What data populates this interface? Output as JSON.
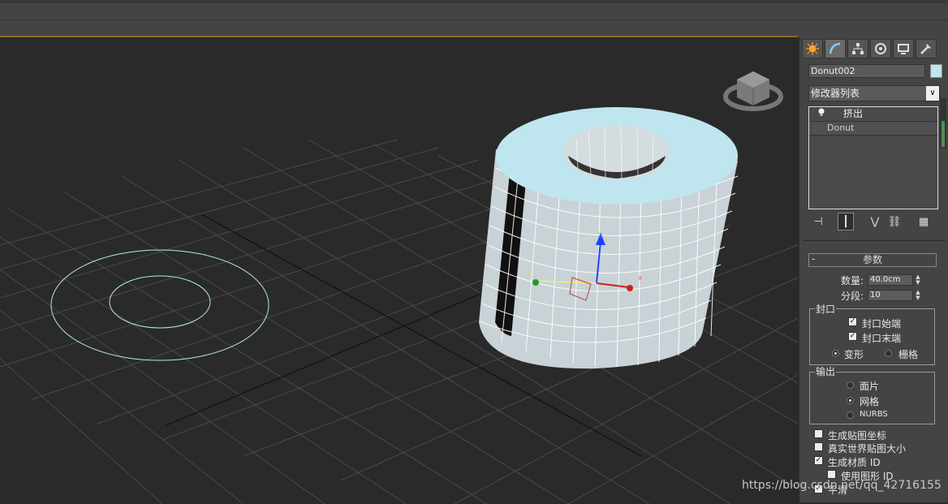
{
  "object_name": "Donut002",
  "object_color": "#bfe6ee",
  "modifier_list_label": "修改器列表",
  "modifier_stack": [
    {
      "label": "挤出",
      "icon": "lightbulb-icon"
    },
    {
      "label": "Donut"
    }
  ],
  "command_tabs": [
    "create-tab-icon",
    "modify-tab-icon",
    "hierarchy-tab-icon",
    "motion-tab-icon",
    "display-tab-icon",
    "utilities-tab-icon"
  ],
  "parameters": {
    "rollout_title": "参数",
    "collapse_symbol": "-",
    "amount_label": "数量:",
    "amount_value": "40.0cm",
    "segments_label": "分段:",
    "segments_value": "10",
    "capping": {
      "group_label": "封口",
      "cap_start": {
        "label": "封口始端",
        "checked": true
      },
      "cap_end": {
        "label": "封口末端",
        "checked": true
      },
      "morph": {
        "label": "变形",
        "selected": true
      },
      "grid": {
        "label": "栅格",
        "selected": false
      }
    },
    "output": {
      "group_label": "输出",
      "patch": {
        "label": "面片",
        "selected": false
      },
      "mesh": {
        "label": "网格",
        "selected": true
      },
      "nurbs": {
        "label": "NURBS",
        "selected": false
      }
    },
    "gen_mapping_coords": {
      "label": "生成贴图坐标",
      "checked": false
    },
    "real_world_map_size": {
      "label": "真实世界贴图大小",
      "checked": false
    },
    "gen_material_ids": {
      "label": "生成材质 ID",
      "checked": true
    },
    "use_shape_ids": {
      "label": "使用图形 ID",
      "checked": false
    },
    "smooth": {
      "label": "平滑",
      "checked": true
    }
  },
  "gizmo_axes": {
    "x": "x",
    "y": "y",
    "z": "z"
  },
  "colors": {
    "viewport_bg": "#2a2a2a",
    "grid_line": "#4a4a4a",
    "spline": "#aee8ee",
    "active_border": "#8a6d2a",
    "object_face": "#bfe6ee"
  },
  "watermark": "https://blog.csdn.net/qq_42716155"
}
